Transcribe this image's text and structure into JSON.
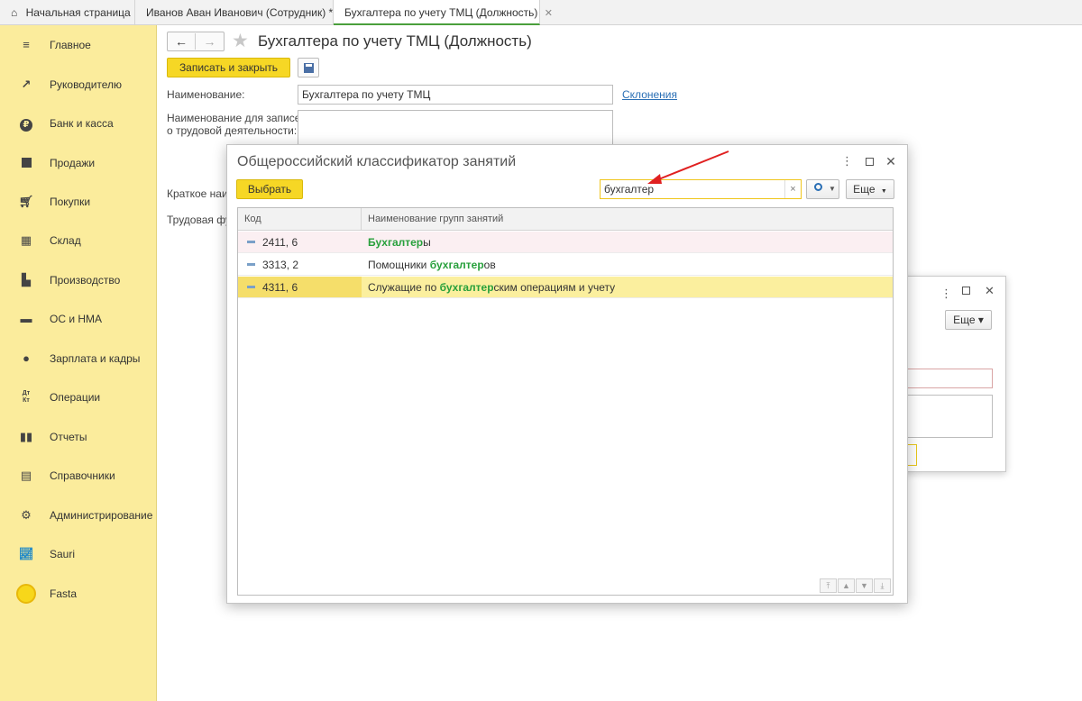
{
  "tabs": [
    {
      "label": "Начальная страница",
      "closable": false
    },
    {
      "label": "Иванов Аван Иванович (Сотрудник) *",
      "closable": true
    },
    {
      "label": "Бухгалтера по учету ТМЦ (Должность)",
      "closable": true
    }
  ],
  "sidebar": {
    "items": [
      {
        "label": "Главное",
        "icon": "menu-icon"
      },
      {
        "label": "Руководителю",
        "icon": "trend-icon"
      },
      {
        "label": "Банк и касса",
        "icon": "ruble-icon"
      },
      {
        "label": "Продажи",
        "icon": "bag-icon"
      },
      {
        "label": "Покупки",
        "icon": "cart-icon"
      },
      {
        "label": "Склад",
        "icon": "warehouse-icon"
      },
      {
        "label": "Производство",
        "icon": "factory-icon"
      },
      {
        "label": "ОС и НМА",
        "icon": "truck-icon"
      },
      {
        "label": "Зарплата и кадры",
        "icon": "person-icon"
      },
      {
        "label": "Операции",
        "icon": "dt-kt-icon"
      },
      {
        "label": "Отчеты",
        "icon": "bar-chart-icon"
      },
      {
        "label": "Справочники",
        "icon": "books-icon"
      },
      {
        "label": "Администрирование",
        "icon": "gear-icon"
      },
      {
        "label": "Sauri",
        "icon": "sauri-chart-icon"
      },
      {
        "label": "Fasta",
        "icon": "fasta-circle-icon"
      }
    ]
  },
  "form": {
    "title": "Бухгалтера по учету ТМЦ (Должность)",
    "save_close_label": "Записать и закрыть",
    "name_label": "Наименование:",
    "name_value": "Бухгалтера по учету ТМЦ",
    "declensions_link": "Склонения",
    "labor_name_label_line1": "Наименование для записей",
    "labor_name_label_line2": "о трудовой деятельности:",
    "short_name_label": "Краткое наим",
    "labor_func_label": "Трудовая фу"
  },
  "bg_dialog": {
    "more_label": "Еще ▾",
    "field_fragment": "о"
  },
  "dialog": {
    "title": "Общероссийский классификатор занятий",
    "select_label": "Выбрать",
    "search_value": "бухгалтер",
    "clear_glyph": "×",
    "more_label": "Еще",
    "columns": [
      "Код",
      "Наименование групп занятий"
    ],
    "rows": [
      {
        "code": "2411, 6",
        "pre": "",
        "match": "Бухгалтер",
        "post": "ы",
        "selected": false
      },
      {
        "code": "3313, 2",
        "pre": "Помощники ",
        "match": "бухгалтер",
        "post": "ов",
        "selected": false
      },
      {
        "code": "4311, 6",
        "pre": "Служащие по ",
        "match": "бухгалтер",
        "post": "ским операциям и учету",
        "selected": true
      }
    ]
  },
  "colors": {
    "sidebar_bg": "#fbec9c",
    "accent_yellow": "#f6d725",
    "highlight_green": "#28a03c",
    "selected_row": "#fbef9e",
    "link_blue": "#2a6fb5"
  }
}
